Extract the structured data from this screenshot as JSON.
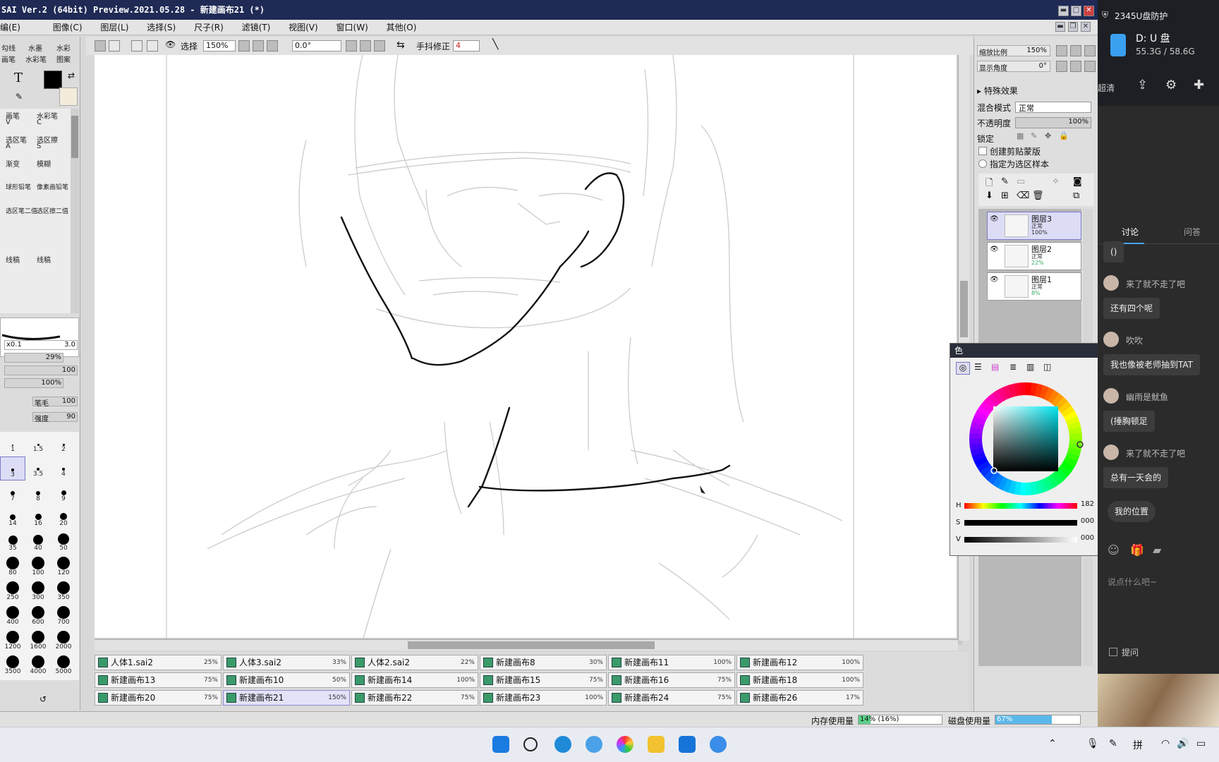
{
  "app": {
    "title": "SAI Ver.2 (64bit) Preview.2021.05.28 - 新建画布21 (*)"
  },
  "menu": [
    "编(E)",
    "图像(C)",
    "图层(L)",
    "选择(S)",
    "尺子(R)",
    "滤镜(T)",
    "视图(V)",
    "窗口(W)",
    "其他(O)"
  ],
  "toolbar": {
    "select_label": "选择",
    "zoom": "150%",
    "angle": "0.0°",
    "stabilizer_label": "手抖修正",
    "stabilizer_value": "4"
  },
  "tools": {
    "tabs": [
      "勾线",
      "水墨",
      "水彩"
    ],
    "tabs2": [
      "画笔",
      "水彩笔",
      "图案"
    ],
    "list": [
      {
        "a": "画笔",
        "ak": "V",
        "b": "水彩笔",
        "bk": "C"
      },
      {
        "a": "选区笔",
        "ak": "A",
        "b": "选区擦",
        "bk": "S"
      },
      {
        "a": "渐变",
        "ak": "",
        "b": "模糊",
        "bk": ""
      },
      {
        "a": "球形铅笔",
        "ak": "",
        "b": "像素画铅笔",
        "bk": ""
      },
      {
        "a": "选区笔二值",
        "ak": "",
        "b": "选区擦二值",
        "bk": ""
      },
      {
        "a": "线稿",
        "ak": "",
        "b": "线稿",
        "bk": ""
      }
    ],
    "size_scale": "x0.1",
    "size_value": "3.0",
    "min_size": "29%",
    "density": "100",
    "density2": "100%",
    "edge_label": "笔毛",
    "edge_value": "100",
    "strength_label": "强度",
    "strength_value": "90",
    "brush_sizes": [
      "1",
      "1.5",
      "2",
      "3",
      "3.5",
      "4",
      "7",
      "8",
      "9",
      "14",
      "16",
      "20",
      "35",
      "40",
      "50",
      "80",
      "100",
      "120",
      "250",
      "300",
      "350",
      "400",
      "600",
      "700",
      "1200",
      "1600",
      "2000",
      "3500",
      "4000",
      "5000"
    ]
  },
  "canvas_tabs": [
    {
      "name": "人体1.sai2",
      "pct": "25%"
    },
    {
      "name": "人体3.sai2",
      "pct": "33%"
    },
    {
      "name": "人体2.sai2",
      "pct": "22%"
    },
    {
      "name": "新建画布8",
      "pct": "30%"
    },
    {
      "name": "新建画布11",
      "pct": "100%"
    },
    {
      "name": "新建画布12",
      "pct": "100%"
    },
    {
      "name": "新建画布13",
      "pct": "75%"
    },
    {
      "name": "新建画布10",
      "pct": "50%"
    },
    {
      "name": "新建画布14",
      "pct": "100%"
    },
    {
      "name": "新建画布15",
      "pct": "75%"
    },
    {
      "name": "新建画布16",
      "pct": "75%"
    },
    {
      "name": "新建画布18",
      "pct": "100%"
    },
    {
      "name": "新建画布20",
      "pct": "75%"
    },
    {
      "name": "新建画布21",
      "pct": "150%"
    },
    {
      "name": "新建画布22",
      "pct": "75%"
    },
    {
      "name": "新建画布23",
      "pct": "100%"
    },
    {
      "name": "新建画布24",
      "pct": "75%"
    },
    {
      "name": "新建画布26",
      "pct": "17%"
    }
  ],
  "active_tab_index": 13,
  "navigator": {
    "zoom_label": "缩放比例",
    "zoom_value": "150%",
    "angle_label": "显示角度",
    "angle_value": "0°"
  },
  "layer_props": {
    "effects_label": "特殊效果",
    "blend_label": "混合模式",
    "blend_value": "正常",
    "opacity_label": "不透明度",
    "opacity_value": "100%",
    "lock_label": "锁定",
    "clip_label": "创建剪贴蒙版",
    "sample_label": "指定为选区样本"
  },
  "layers": [
    {
      "name": "图层3",
      "mode": "正常",
      "opacity": "100%"
    },
    {
      "name": "图层2",
      "mode": "正常",
      "opacity": "22%"
    },
    {
      "name": "图层1",
      "mode": "正常",
      "opacity": "8%"
    }
  ],
  "color": {
    "title": "色",
    "h_label": "H",
    "h_value": "182",
    "s_label": "S",
    "s_value": "000",
    "v_label": "V",
    "v_value": "000"
  },
  "status": {
    "memory_label": "内存使用量",
    "memory_value": "14% (16%)",
    "memory_fill": 0.14,
    "disk_label": "磁盘使用量",
    "disk_value": "67%",
    "disk_fill": 0.67
  },
  "usb": {
    "header": "2345U盘防护",
    "drive": "D: U 盘",
    "capacity": "55.3G / 58.6G",
    "quality": "超清"
  },
  "live": {
    "tab_discuss": "讨论",
    "tab_qa": "问答",
    "messages": [
      {
        "type": "msg",
        "text": "()"
      },
      {
        "type": "user",
        "name": "来了就不走了吧"
      },
      {
        "type": "msg",
        "text": "还有四个呢"
      },
      {
        "type": "user",
        "name": "吹吹"
      },
      {
        "type": "msg",
        "text": "我也像被老师抽到TAT"
      },
      {
        "type": "user",
        "name": "幽雨是鱿鱼"
      },
      {
        "type": "msg",
        "text": "(捶胸顿足"
      },
      {
        "type": "user",
        "name": "来了就不走了吧"
      },
      {
        "type": "msg",
        "text": "总有一天会的"
      }
    ],
    "location": "我的位置",
    "input_placeholder": "说点什么吧~",
    "ask_label": "提问"
  },
  "colors": {
    "accent": "#7a7ac8",
    "titlebar": "#1f2a55",
    "mem_fill": "#5cd18a",
    "disk_fill": "#5ab8e8"
  }
}
